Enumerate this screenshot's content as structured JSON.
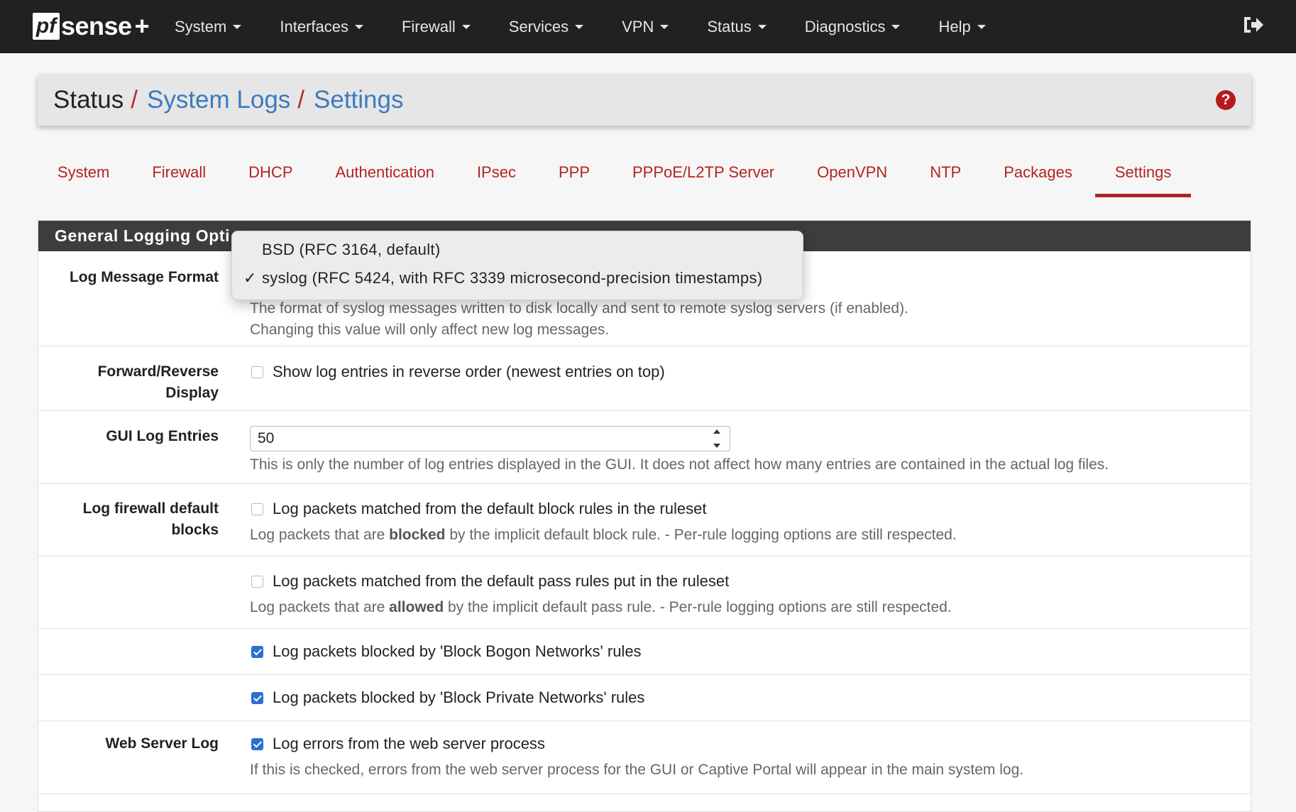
{
  "navbar": {
    "brand_pf": "pf",
    "brand_sense": "sense",
    "brand_plus": "+",
    "menu": [
      {
        "label": "System"
      },
      {
        "label": "Interfaces"
      },
      {
        "label": "Firewall"
      },
      {
        "label": "Services"
      },
      {
        "label": "VPN"
      },
      {
        "label": "Status"
      },
      {
        "label": "Diagnostics"
      },
      {
        "label": "Help"
      }
    ],
    "logout_icon": "logout-icon"
  },
  "breadcrumb": {
    "root": "Status",
    "sep": "/",
    "level1": "System Logs",
    "level2": "Settings",
    "help_glyph": "?"
  },
  "tabs": [
    {
      "label": "System",
      "active": false
    },
    {
      "label": "Firewall",
      "active": false
    },
    {
      "label": "DHCP",
      "active": false
    },
    {
      "label": "Authentication",
      "active": false
    },
    {
      "label": "IPsec",
      "active": false
    },
    {
      "label": "PPP",
      "active": false
    },
    {
      "label": "PPPoE/L2TP Server",
      "active": false
    },
    {
      "label": "OpenVPN",
      "active": false
    },
    {
      "label": "NTP",
      "active": false
    },
    {
      "label": "Packages",
      "active": false
    },
    {
      "label": "Settings",
      "active": true
    }
  ],
  "panel": {
    "heading": "General Logging Opti",
    "log_message_format": {
      "label": "Log Message Format",
      "help_1": "The format of syslog messages written to disk locally and sent to remote syslog servers (if enabled).",
      "help_2": "Changing this value will only affect new log messages."
    },
    "forward_reverse": {
      "label_1": "Forward/Reverse",
      "label_2": "Display",
      "checkbox_label": "Show log entries in reverse order (newest entries on top)",
      "checked": false
    },
    "gui_log_entries": {
      "label": "GUI Log Entries",
      "value": "50",
      "help": "This is only the number of log entries displayed in the GUI. It does not affect how many entries are contained in the actual log files."
    },
    "log_fw_default_blocks": {
      "label_1": "Log firewall default",
      "label_2": "blocks",
      "checkbox_label": "Log packets matched from the default block rules in the ruleset",
      "checked": false,
      "help_pre": "Log packets that are ",
      "help_bold": "blocked",
      "help_post": " by the implicit default block rule. - Per-rule logging options are still respected."
    },
    "log_fw_default_pass": {
      "checkbox_label": "Log packets matched from the default pass rules put in the ruleset",
      "checked": false,
      "help_pre": "Log packets that are ",
      "help_bold": "allowed",
      "help_post": " by the implicit default pass rule. - Per-rule logging options are still respected."
    },
    "log_bogon": {
      "checkbox_label": "Log packets blocked by 'Block Bogon Networks' rules",
      "checked": true
    },
    "log_private": {
      "checkbox_label": "Log packets blocked by 'Block Private Networks' rules",
      "checked": true
    },
    "web_server_log": {
      "label": "Web Server Log",
      "checkbox_label": "Log errors from the web server process",
      "checked": true,
      "help": "If this is checked, errors from the web server process for the GUI or Captive Portal will appear in the main system log."
    }
  },
  "dropdown": {
    "check_glyph": "✓",
    "options": [
      {
        "label": "BSD (RFC 3164, default)",
        "selected": false
      },
      {
        "label": "syslog (RFC 5424, with RFC 3339 microsecond-precision timestamps)",
        "selected": true
      }
    ]
  },
  "colors": {
    "navbar_bg": "#212121",
    "accent_red": "#b22424",
    "link_blue": "#3b7bbf",
    "panel_heading_bg": "#3d3d3d",
    "checkbox_blue": "#2b6fd1"
  }
}
